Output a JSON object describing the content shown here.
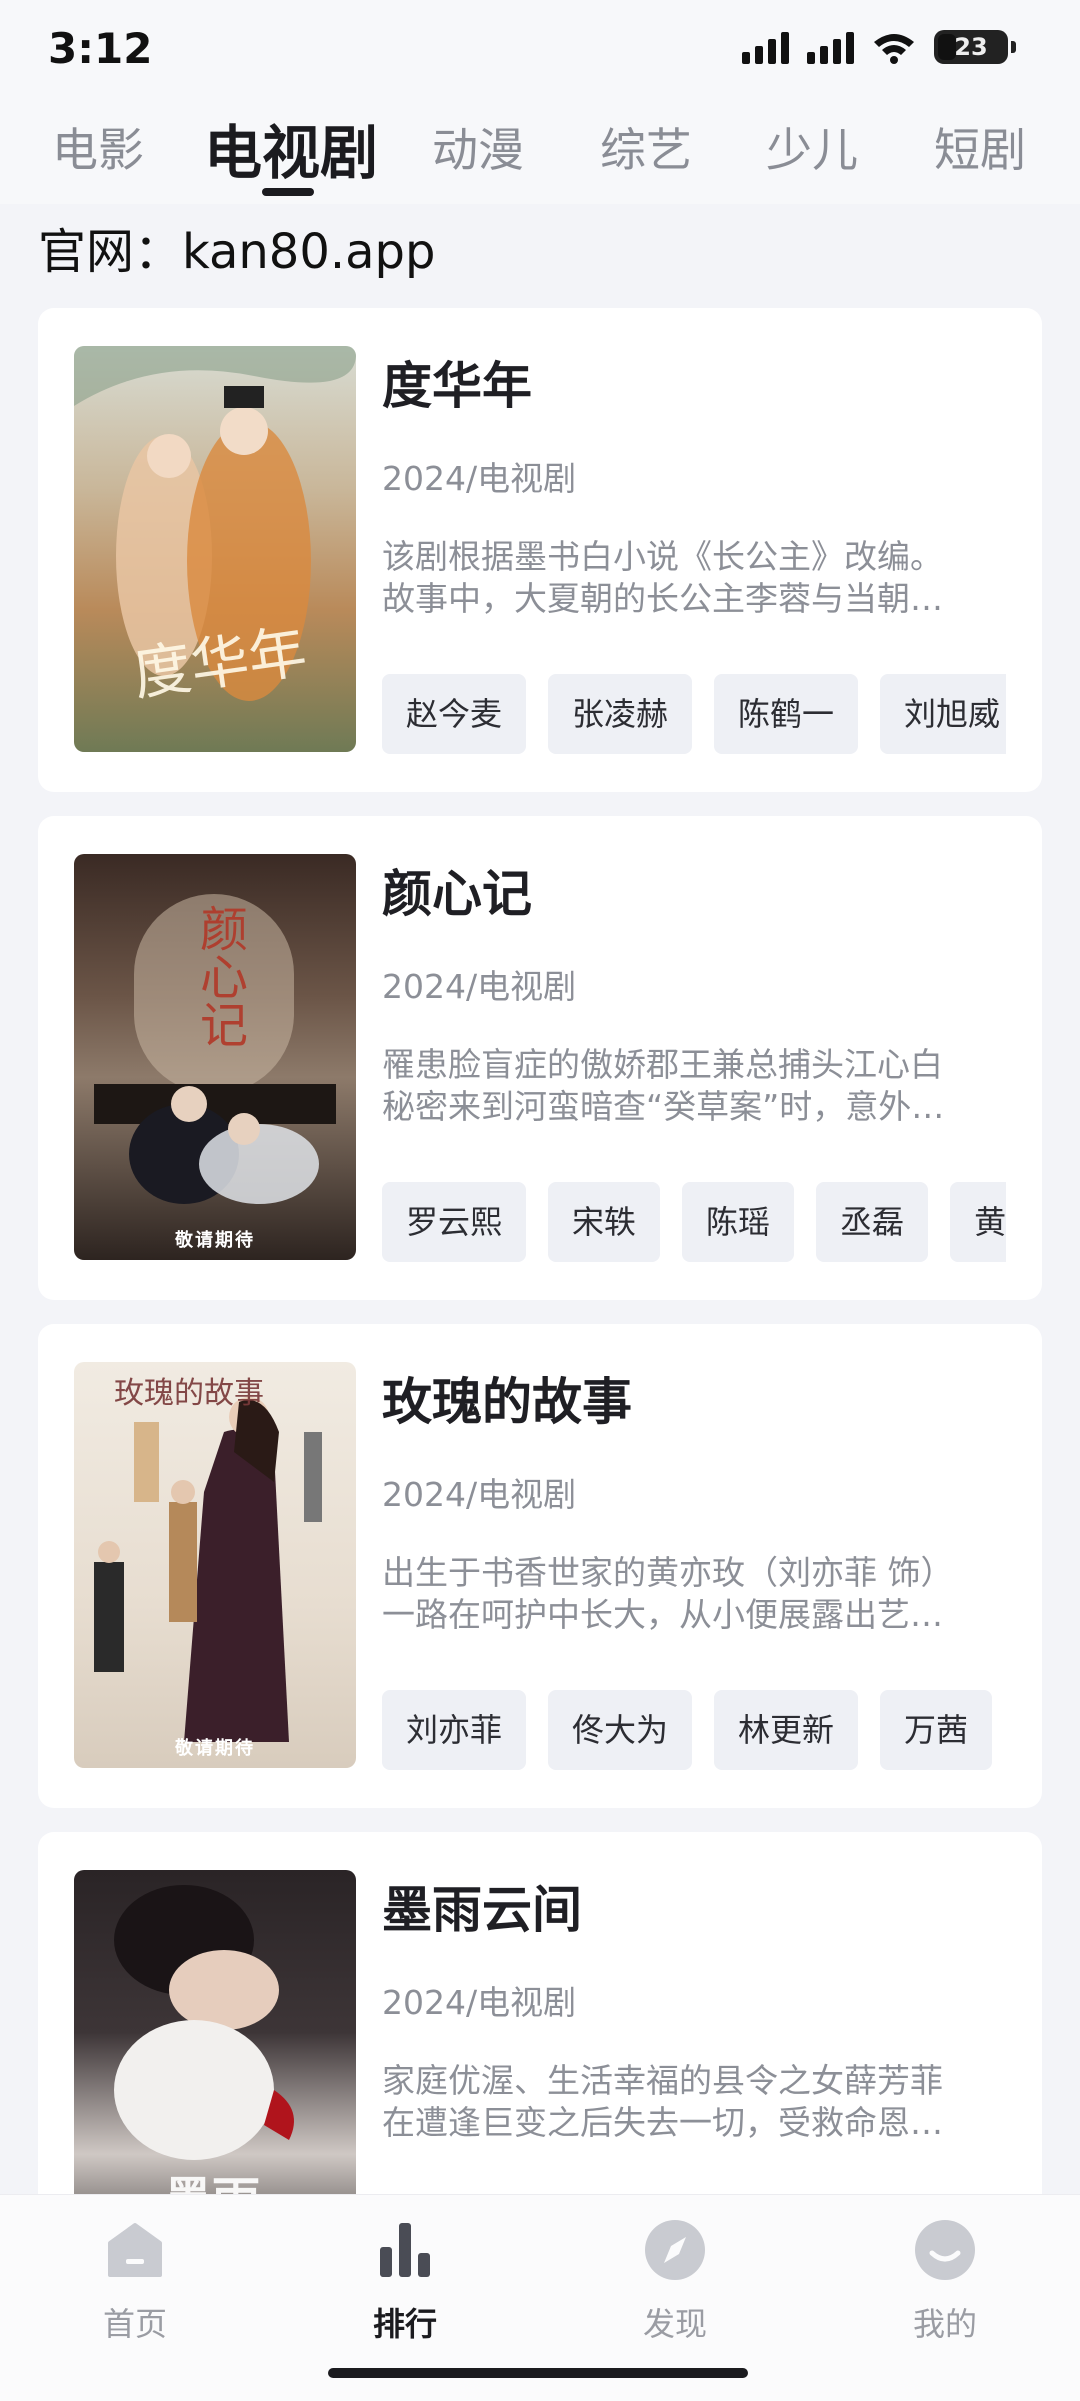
{
  "status": {
    "time": "3:12",
    "battery": "23"
  },
  "tabs": [
    "电影",
    "电视剧",
    "动漫",
    "综艺",
    "少儿",
    "短剧"
  ],
  "site_notice": "官网：kan80.app",
  "cards": [
    {
      "title": "度华年",
      "meta": "2024/电视剧",
      "desc": [
        "该剧根据墨书白小说《长公主》改编。",
        "故事中，大夏朝的长公主李蓉与当朝…"
      ],
      "actors": [
        "赵今麦",
        "张凌赫",
        "陈鹤一",
        "刘旭威"
      ],
      "poster_badge": "",
      "poster_art": "度华年"
    },
    {
      "title": "颜心记",
      "meta": "2024/电视剧",
      "desc": [
        "罹患脸盲症的傲娇郡王兼总捕头江心白",
        "秘密来到河蛮暗查“癸草案”时，意外…"
      ],
      "actors": [
        "罗云熙",
        "宋轶",
        "陈瑶",
        "丞磊",
        "黄"
      ],
      "poster_badge": "敬请期待",
      "poster_art": "颜心记"
    },
    {
      "title": "玫瑰的故事",
      "meta": "2024/电视剧",
      "desc": [
        "出生于书香世家的黄亦玫（刘亦菲 饰）",
        "一路在呵护中长大，从小便展露出艺…"
      ],
      "actors": [
        "刘亦菲",
        "佟大为",
        "林更新",
        "万茜"
      ],
      "poster_badge": "敬请期待",
      "poster_art": "玫瑰的故事"
    },
    {
      "title": "墨雨云间",
      "meta": "2024/电视剧",
      "desc": [
        "家庭优渥、生活幸福的县令之女薛芳菲",
        "在遭逢巨变之后失去一切，受救命恩…"
      ],
      "actors": [],
      "poster_badge": "",
      "poster_art": "墨雨"
    }
  ],
  "bottom_nav": [
    {
      "label": "首页",
      "icon": "home-icon"
    },
    {
      "label": "排行",
      "icon": "ranking-icon"
    },
    {
      "label": "发现",
      "icon": "discover-icon"
    },
    {
      "label": "我的",
      "icon": "profile-icon"
    }
  ],
  "colors": {
    "accent": "#1b1b1f",
    "muted": "#8c8f97",
    "chip_bg": "#eef0f5",
    "page_bg": "#f3f4f8"
  }
}
